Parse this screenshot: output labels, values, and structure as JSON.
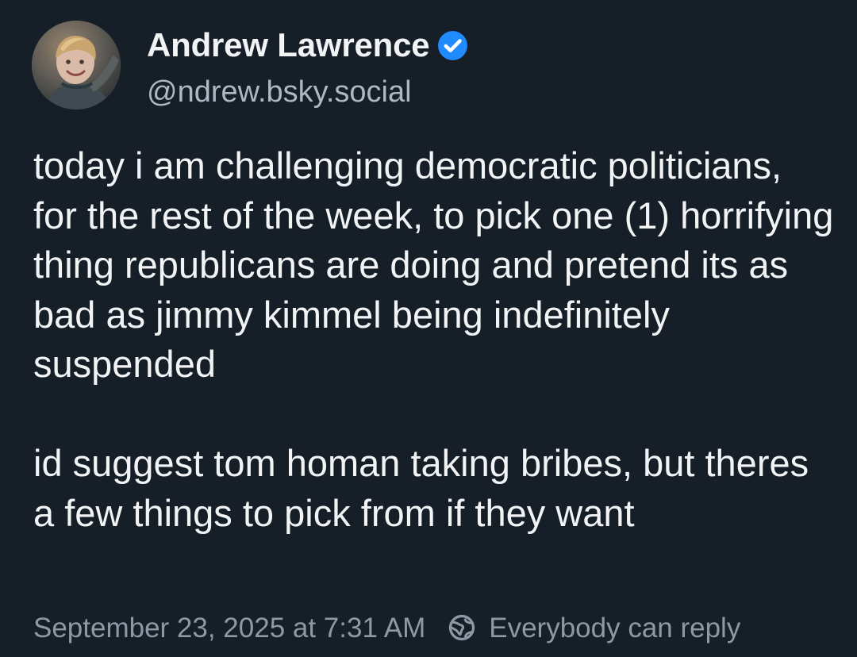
{
  "author": {
    "display_name": "Andrew Lawrence",
    "handle": "@ndrew.bsky.social",
    "verified": true,
    "avatar_icon": "avatar-photo"
  },
  "post": {
    "text": "today i am challenging democratic politicians, for the rest of the week, to pick one (1) horrifying thing republicans are doing and pretend its as bad as jimmy kimmel being indefinitely suspended\n\nid suggest tom homan taking bribes, but theres a few things to pick from if they want",
    "timestamp": "September 23, 2025 at 7:31 AM",
    "reply_setting": "Everybody can reply"
  },
  "colors": {
    "background": "#161e27",
    "text_primary": "#f1f3f5",
    "text_secondary": "#aeb8c4",
    "text_muted": "#8e99a6",
    "verified_badge": "#208bfe"
  },
  "icons": {
    "verified": "verified-badge-icon",
    "reply_setting": "earth-icon"
  }
}
